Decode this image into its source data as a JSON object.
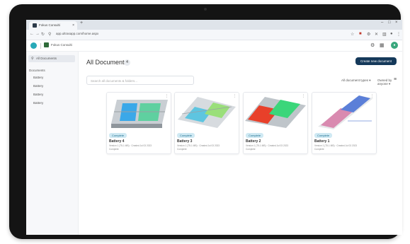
{
  "browser": {
    "tab_title": "Fokus Consulti",
    "tab_close": "×",
    "new_tab": "+",
    "url": "app.ultrasapp.com/home.aspx",
    "win_controls": [
      "–",
      "□",
      "×"
    ]
  },
  "app": {
    "workspace_name": "Fokus Consulti",
    "avatar_initial": "●"
  },
  "sidebar": {
    "search_label": "All Documents",
    "items": [
      "Documents",
      "Battery",
      "Battery",
      "Battery",
      "Battery"
    ]
  },
  "main": {
    "title": "All Documents",
    "count": "4",
    "create_button": "Create new document",
    "search_placeholder": "Search all documents & folders...",
    "filter_type": "All document types ▾",
    "filter_owner": "Owned by anyone ▾"
  },
  "documents": [
    {
      "name": "Battery 4",
      "badge": "Complete",
      "desc": "Version 1 (T5-1 MB) · Created Jul 03 2023",
      "sub": "Complete",
      "colors": [
        "#3ba8e8",
        "#5fd0a0"
      ]
    },
    {
      "name": "Battery 3",
      "badge": "Complete",
      "desc": "Version 1 (T5-1 MB) · Created Jul 03 2023",
      "sub": "Complete",
      "colors": [
        "#5ec5e0",
        "#9adf7a"
      ]
    },
    {
      "name": "Battery 2",
      "badge": "Complete",
      "desc": "Version 1 (T5-1 MB) · Created Jul 03 2023",
      "sub": "Complete",
      "colors": [
        "#e8402a",
        "#3bd67a"
      ]
    },
    {
      "name": "Battery 1",
      "badge": "Complete",
      "desc": "Version 1 (T5-1 MB) · Created Jul 03 2023",
      "sub": "Complete",
      "colors": [
        "#d98ab0",
        "#5b7fd8"
      ]
    }
  ],
  "colors": {
    "accent": "#15395a",
    "badge_bg": "#cfe9f3",
    "brand": "#27a9b8"
  }
}
